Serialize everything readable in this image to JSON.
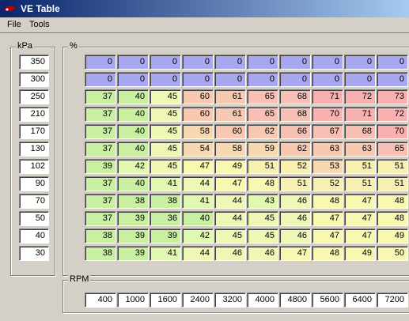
{
  "window": {
    "title": "VE Table"
  },
  "menu": [
    {
      "label": "File"
    },
    {
      "label": "Tools"
    }
  ],
  "kpa": {
    "label": "kPa",
    "values": [
      "350",
      "300",
      "250",
      "210",
      "170",
      "130",
      "102",
      "90",
      "70",
      "50",
      "40",
      "30"
    ]
  },
  "ve": {
    "label": "%",
    "rows": [
      [
        "0",
        "0",
        "0",
        "0",
        "0",
        "0",
        "0",
        "0",
        "0",
        "0"
      ],
      [
        "0",
        "0",
        "0",
        "0",
        "0",
        "0",
        "0",
        "0",
        "0",
        "0"
      ],
      [
        "37",
        "40",
        "45",
        "60",
        "61",
        "65",
        "68",
        "71",
        "72",
        "73"
      ],
      [
        "37",
        "40",
        "45",
        "60",
        "61",
        "65",
        "68",
        "70",
        "71",
        "72"
      ],
      [
        "37",
        "40",
        "45",
        "58",
        "60",
        "62",
        "66",
        "67",
        "68",
        "70"
      ],
      [
        "37",
        "40",
        "45",
        "54",
        "58",
        "59",
        "62",
        "63",
        "63",
        "65"
      ],
      [
        "39",
        "42",
        "45",
        "47",
        "49",
        "51",
        "52",
        "53",
        "51",
        "51"
      ],
      [
        "37",
        "40",
        "41",
        "44",
        "47",
        "48",
        "51",
        "52",
        "51",
        "51"
      ],
      [
        "37",
        "38",
        "38",
        "41",
        "44",
        "43",
        "46",
        "48",
        "47",
        "48"
      ],
      [
        "37",
        "39",
        "36",
        "40",
        "44",
        "45",
        "46",
        "47",
        "47",
        "48"
      ],
      [
        "38",
        "39",
        "39",
        "42",
        "45",
        "45",
        "46",
        "47",
        "47",
        "49"
      ],
      [
        "38",
        "39",
        "41",
        "44",
        "46",
        "46",
        "47",
        "48",
        "49",
        "50"
      ]
    ]
  },
  "rpm": {
    "label": "RPM",
    "values": [
      "400",
      "1000",
      "1600",
      "2400",
      "3200",
      "4000",
      "4800",
      "5600",
      "6400",
      "7200"
    ]
  }
}
